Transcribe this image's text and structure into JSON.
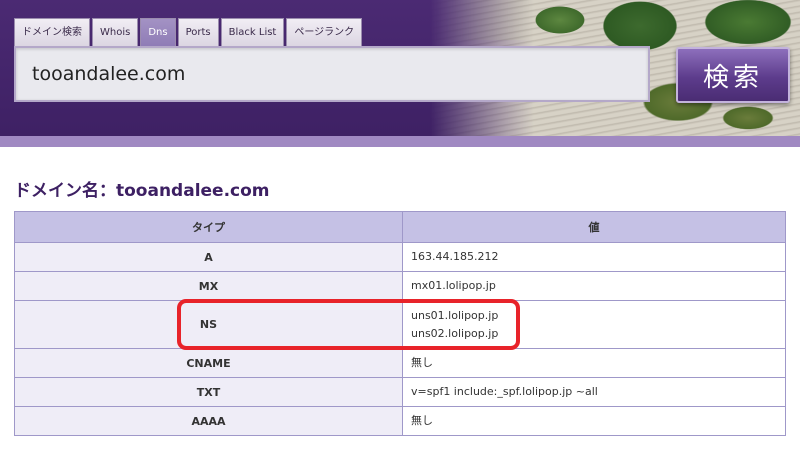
{
  "header": {
    "tabs": [
      {
        "label": "ドメイン検索",
        "active": false
      },
      {
        "label": "Whois",
        "active": false
      },
      {
        "label": "Dns",
        "active": true
      },
      {
        "label": "Ports",
        "active": false
      },
      {
        "label": "Black List",
        "active": false
      },
      {
        "label": "ページランク",
        "active": false
      }
    ],
    "search_value": "tooandalee.com",
    "search_button_label": "検索"
  },
  "main": {
    "title": "ドメイン名：tooandalee.com",
    "table": {
      "headers": [
        "タイプ",
        "値"
      ],
      "rows": [
        {
          "type": "A",
          "values": [
            "163.44.185.212"
          ]
        },
        {
          "type": "MX",
          "values": [
            "mx01.lolipop.jp"
          ]
        },
        {
          "type": "NS",
          "values": [
            "uns01.lolipop.jp",
            "uns02.lolipop.jp"
          ]
        },
        {
          "type": "CNAME",
          "values": [
            "無し"
          ]
        },
        {
          "type": "TXT",
          "values": [
            "v=spf1 include:_spf.lolipop.jp ~all"
          ]
        },
        {
          "type": "AAAA",
          "values": [
            "無し"
          ]
        }
      ]
    }
  },
  "colors": {
    "header_bg": "#3d2063",
    "active_tab": "#8f7cb6",
    "table_header": "#c5c1e5",
    "highlight": "#e8232a"
  }
}
